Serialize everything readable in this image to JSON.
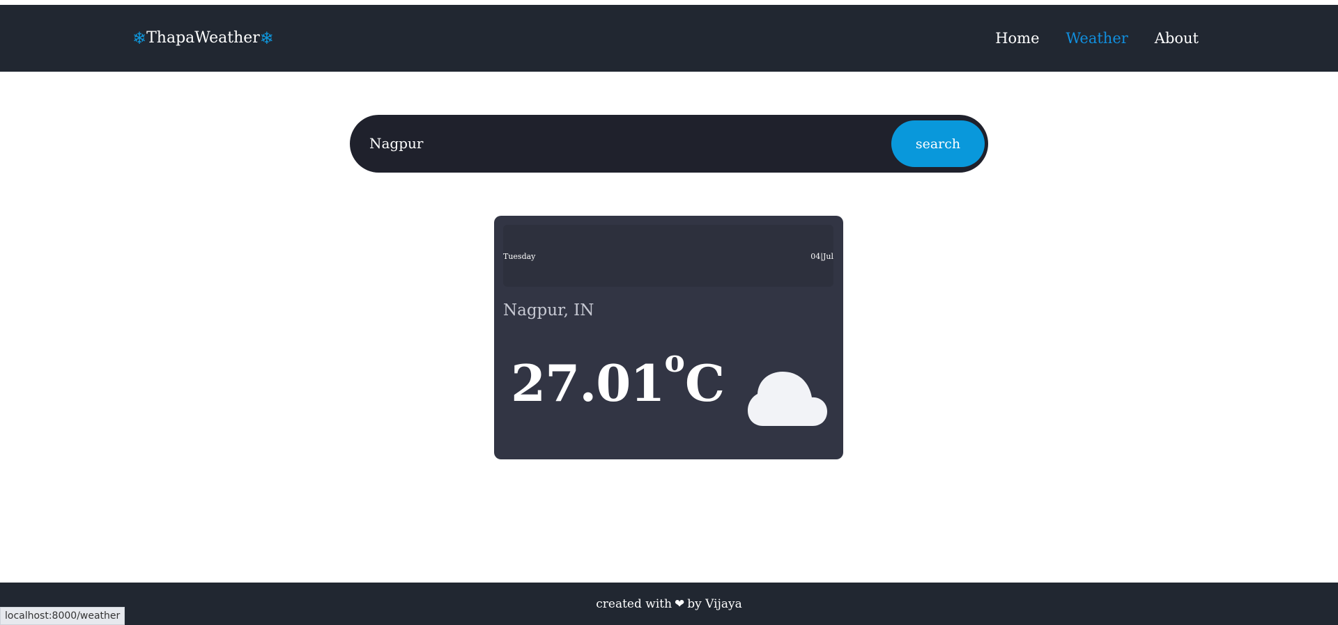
{
  "brand": {
    "name": "ThapaWeather",
    "left_icon": "snowflake-icon",
    "right_icon": "snowflake-icon",
    "left_glyph": "❄",
    "right_glyph": "❄",
    "accent_color": "#0f96db"
  },
  "nav": {
    "items": [
      {
        "label": "Home",
        "active": false
      },
      {
        "label": "Weather",
        "active": true
      },
      {
        "label": "About",
        "active": false
      }
    ]
  },
  "search": {
    "value": "Nagpur",
    "button_label": "search"
  },
  "weather_card": {
    "day": "Tuesday",
    "date": "04|Jul",
    "location": "Nagpur, IN",
    "temperature": "27.01",
    "degree_symbol": "o",
    "unit": "C",
    "condition_icon": "cloud-icon"
  },
  "footer": {
    "prefix": "created with",
    "heart_icon": "heart-icon",
    "heart_glyph": "❤",
    "suffix": "by Vijaya"
  },
  "status_bar": {
    "url": "localhost:8000/weather"
  },
  "colors": {
    "navbar": "#212731",
    "search_bar": "#1f212c",
    "search_button": "#0998db",
    "card": "#323544",
    "active_nav": "#118fde"
  }
}
